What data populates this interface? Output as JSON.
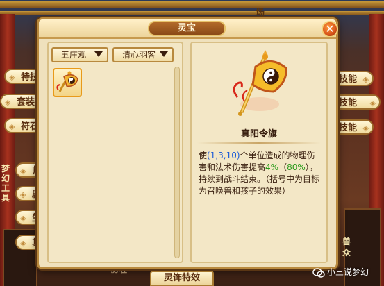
{
  "dialog": {
    "title": "灵宝",
    "close_glyph": "✕"
  },
  "filters": {
    "school": "五庄观",
    "category": "清心羽客"
  },
  "items": [
    {
      "name": "真阳令旗",
      "selected": true,
      "icon": "yin-yang-flag-icon"
    }
  ],
  "detail": {
    "name": "真阳令旗",
    "desc_1": "使",
    "desc_targets": "(1,3,10)",
    "desc_2": "个单位造成的物理伤害和法术伤害提高",
    "desc_pct": "4%",
    "desc_3": "（",
    "desc_pct2": "80%",
    "desc_4": "），持续到战斗结束。（括号中为目标为召唤兽和孩子的效果）"
  },
  "background": {
    "left_tabs": [
      "特技",
      "套装",
      "符石",
      "师门",
      "剧情",
      "生活",
      "其他"
    ],
    "right_tabs": [
      "技能",
      "技能",
      "技能"
    ],
    "top_sign": "场",
    "left_vertical": "梦幻工具",
    "right_vertical": "兽众",
    "bottom_tab": "灵饰特效",
    "bottom_left_glyph": "历程"
  },
  "watermark": "小三说梦幻",
  "colors": {
    "accent": "#b98a3e",
    "highlight_blue": "#1a5ad8",
    "highlight_green": "#2a9a1a"
  }
}
